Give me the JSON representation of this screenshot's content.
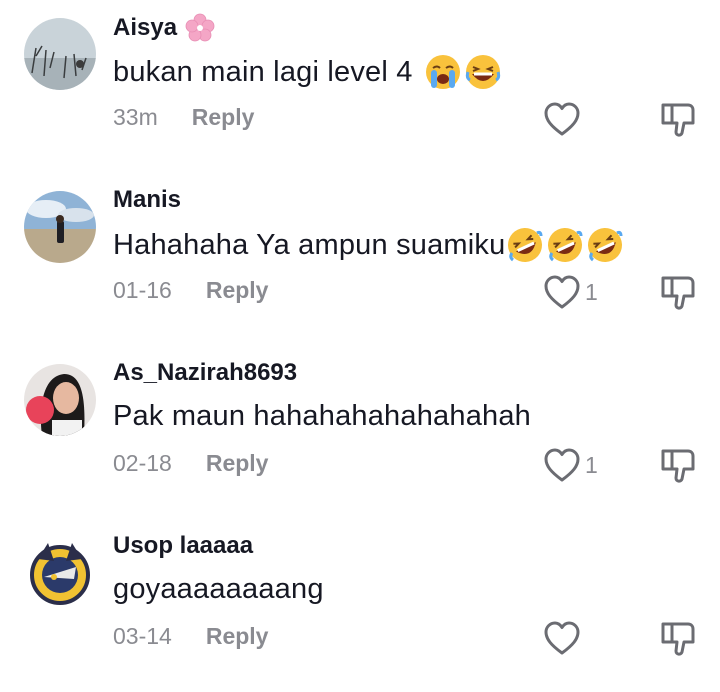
{
  "comments": [
    {
      "username": "Aisya",
      "has_flower": true,
      "text": "bukan main lagi level 4",
      "emojis": [
        "crying-face",
        "laughing-face"
      ],
      "time": "33m",
      "reply": "Reply",
      "likes": ""
    },
    {
      "username": "Manis",
      "has_flower": false,
      "text": "Hahahaha Ya ampun suamiku",
      "emojis": [
        "rofl",
        "rofl",
        "rofl"
      ],
      "time": "01-16",
      "reply": "Reply",
      "likes": "1"
    },
    {
      "username": "As_Nazirah8693",
      "has_flower": false,
      "text": "Pak maun hahahahahahahahah",
      "emojis": [],
      "time": "02-18",
      "reply": "Reply",
      "likes": "1"
    },
    {
      "username": "Usop laaaaa",
      "has_flower": false,
      "text": "goyaaaaaaaang",
      "emojis": [],
      "time": "03-14",
      "reply": "Reply",
      "likes": ""
    }
  ],
  "icons": {
    "like": "heart-outline-icon",
    "dislike": "thumbs-down-icon",
    "flower": "cherry-blossom-icon"
  }
}
